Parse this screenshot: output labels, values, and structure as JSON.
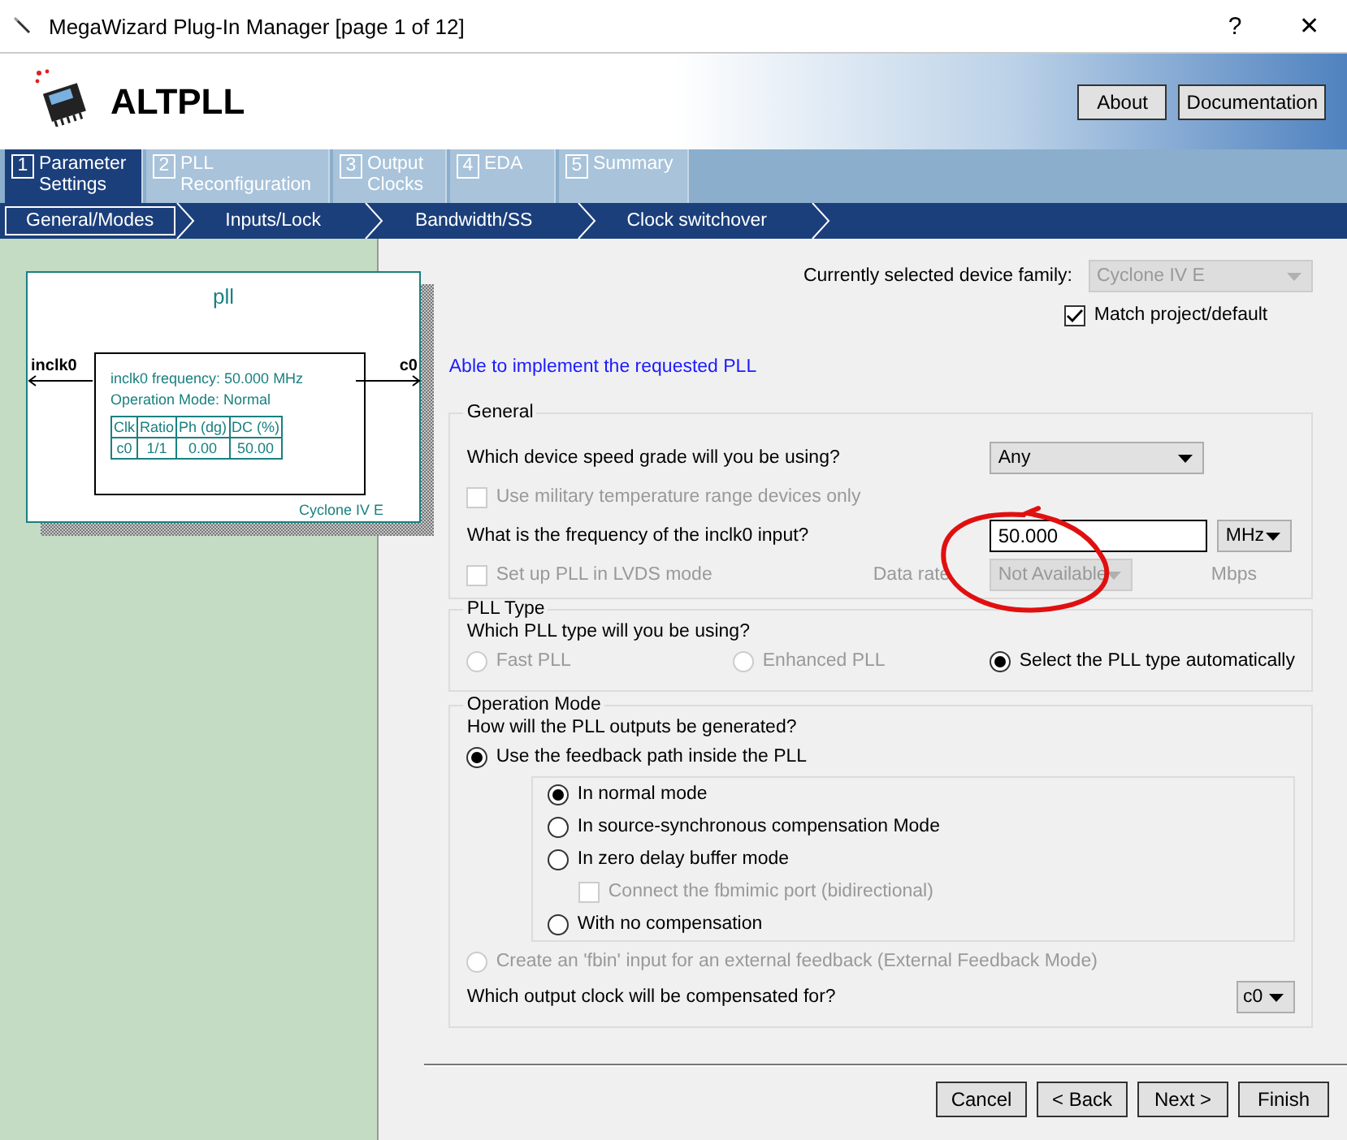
{
  "window": {
    "title": "MegaWizard Plug-In Manager [page 1 of 12]",
    "help": "?",
    "close": "✕"
  },
  "header": {
    "title": "ALTPLL",
    "buttons": [
      "About",
      "Documentation"
    ]
  },
  "tabs": [
    {
      "number": "1",
      "label": "Parameter Settings",
      "selected": true
    },
    {
      "number": "2",
      "label": "PLL Reconfiguration",
      "selected": false
    },
    {
      "number": "3",
      "label": "Output Clocks",
      "selected": false
    },
    {
      "number": "4",
      "label": "EDA",
      "selected": false
    },
    {
      "number": "5",
      "label": "Summary",
      "selected": false
    }
  ],
  "subtabs": [
    {
      "label": "General/Modes",
      "selected": true
    },
    {
      "label": "Inputs/Lock",
      "selected": false
    },
    {
      "label": "Bandwidth/SS",
      "selected": false
    },
    {
      "label": "Clock switchover",
      "selected": false
    }
  ],
  "diagram": {
    "name": "pll",
    "input": "inclk0",
    "output": "c0",
    "lines": [
      "inclk0 frequency: 50.000 MHz",
      "Operation Mode: Normal"
    ],
    "table": {
      "columns": [
        "Clk",
        "Ratio",
        "Ph (dg)",
        "DC (%)"
      ],
      "rows": [
        [
          "c0",
          "1/1",
          "0.00",
          "50.00"
        ]
      ]
    },
    "device": "Cyclone IV E"
  },
  "device_family": {
    "label": "Currently selected device family:",
    "value": "Cyclone IV E",
    "disabled": true
  },
  "match_project": {
    "label": "Match project/default",
    "checked": true
  },
  "status": "Able to implement the requested PLL",
  "general": {
    "title": "General",
    "speed_grade": {
      "label": "Which device speed grade will you be using?",
      "value": "Any"
    },
    "military": {
      "label": "Use military temperature range devices only",
      "checked": false,
      "disabled": true
    },
    "frequency": {
      "label": "What is the frequency of the inclk0 input?",
      "value": "50.000",
      "unit": "MHz"
    },
    "lvds": {
      "label": "Set up PLL in LVDS mode",
      "checked": false,
      "disabled": true
    },
    "data_rate": {
      "label": "Data rate",
      "value": "Not Available",
      "unit": "Mbps",
      "disabled": true
    }
  },
  "pll_type": {
    "title": "PLL Type",
    "question": "Which PLL type will you be using?",
    "options": [
      {
        "label": "Fast PLL",
        "selected": false,
        "disabled": true
      },
      {
        "label": "Enhanced PLL",
        "selected": false,
        "disabled": true
      },
      {
        "label": "Select the PLL type automatically",
        "selected": true,
        "disabled": false
      }
    ]
  },
  "operation_mode": {
    "title": "Operation Mode",
    "question": "How will the PLL outputs be generated?",
    "feedback": {
      "label": "Use the feedback path inside the PLL",
      "selected": true
    },
    "modes": [
      {
        "kind": "radio",
        "label": "In normal mode",
        "selected": true,
        "disabled": false
      },
      {
        "kind": "radio",
        "label": "In source-synchronous compensation Mode",
        "selected": false,
        "disabled": false
      },
      {
        "kind": "radio",
        "label": "In zero delay buffer mode",
        "selected": false,
        "disabled": false
      },
      {
        "kind": "checkbox",
        "label": "Connect the fbmimic port (bidirectional)",
        "checked": false,
        "disabled": true
      },
      {
        "kind": "radio",
        "label": "With no compensation",
        "selected": false,
        "disabled": false
      }
    ],
    "external": {
      "label": "Create an 'fbin' input for an external feedback (External Feedback Mode)",
      "selected": false,
      "disabled": true
    },
    "compensated": {
      "label": "Which output clock will be compensated for?",
      "value": "c0"
    }
  },
  "footer_buttons": [
    "Cancel",
    "< Back",
    "Next >",
    "Finish"
  ]
}
